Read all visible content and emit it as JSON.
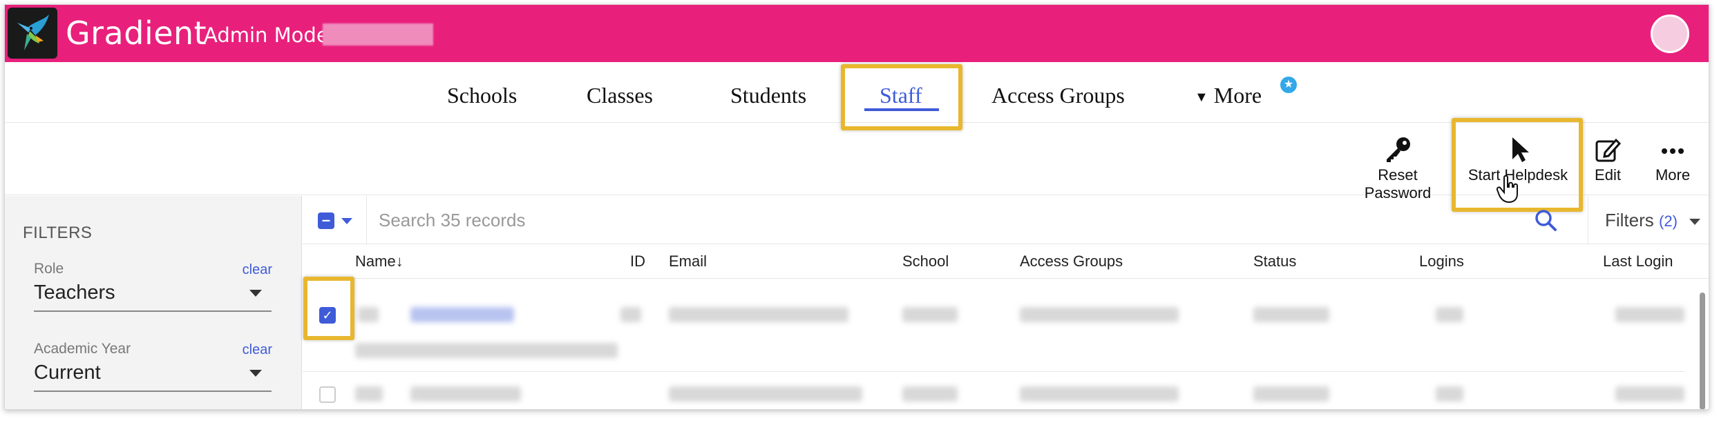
{
  "header": {
    "app_title": "Gradient",
    "mode_label": "Admin Mode",
    "brand_color": "#e8207c"
  },
  "nav": {
    "items": [
      {
        "label": "Schools"
      },
      {
        "label": "Classes"
      },
      {
        "label": "Students"
      },
      {
        "label": "Staff",
        "active": true
      },
      {
        "label": "Access Groups"
      },
      {
        "label": "More"
      }
    ],
    "accent_color": "#3f5bd8"
  },
  "toolbar": {
    "reset_password": "Reset Password",
    "start_helpdesk": "Start Helpdesk",
    "edit": "Edit",
    "more": "More"
  },
  "sidebar": {
    "title": "FILTERS",
    "filters": [
      {
        "label": "Role",
        "clear": "clear",
        "value": "Teachers"
      },
      {
        "label": "Academic Year",
        "clear": "clear",
        "value": "Current"
      }
    ]
  },
  "search": {
    "placeholder": "Search 35 records",
    "filters_label": "Filters",
    "filters_count": "(2)"
  },
  "table": {
    "columns": [
      "Name",
      "ID",
      "Email",
      "School",
      "Access Groups",
      "Status",
      "Logins",
      "Last Login"
    ],
    "sort_indicator": "↓",
    "rows": [
      {
        "selected": true
      },
      {
        "selected": false
      }
    ]
  },
  "highlight_color": "#e8b72f"
}
